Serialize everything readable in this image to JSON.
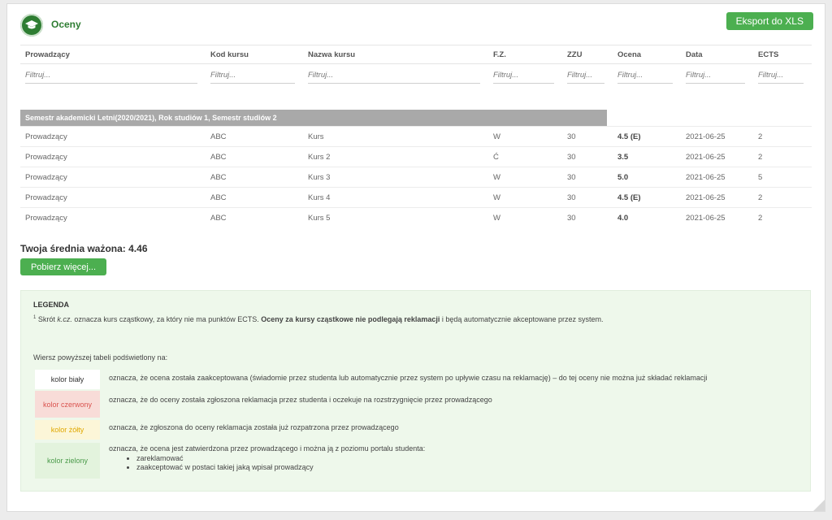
{
  "header": {
    "title": "Oceny",
    "export_label": "Eksport do XLS"
  },
  "table": {
    "columns": [
      "Prowadzący",
      "Kod kursu",
      "Nazwa kursu",
      "F.Z.",
      "ZZU",
      "Ocena",
      "Data",
      "ECTS"
    ],
    "filter_placeholder": "Filtruj...",
    "semester": "Semestr akademicki Letni(2020/2021), Rok studiów 1, Semestr studiów 2",
    "rows": [
      [
        "Prowadzący",
        "ABC",
        "Kurs",
        "W",
        "30",
        "4.5 (E)",
        "2021-06-25",
        "2"
      ],
      [
        "Prowadzący",
        "ABC",
        "Kurs 2",
        "Ć",
        "30",
        "3.5",
        "2021-06-25",
        "2"
      ],
      [
        "Prowadzący",
        "ABC",
        "Kurs 3",
        "W",
        "30",
        "5.0",
        "2021-06-25",
        "5"
      ],
      [
        "Prowadzący",
        "ABC",
        "Kurs 4",
        "W",
        "30",
        "4.5 (E)",
        "2021-06-25",
        "2"
      ],
      [
        "Prowadzący",
        "ABC",
        "Kurs 5",
        "W",
        "30",
        "4.0",
        "2021-06-25",
        "2"
      ]
    ]
  },
  "average": "Twoja średnia ważona: 4.46",
  "more_label": "Pobierz więcej...",
  "legend": {
    "title": "LEGENDA",
    "footnote_mark": "1",
    "note_prefix": " Skrót ",
    "note_abbr": "k.cz.",
    "note_mid": " oznacza kurs cząstkowy, za który nie ma punktów ECTS. ",
    "note_bold": "Oceny za kursy cząstkowe nie podlegają reklamacji",
    "note_suffix": " i będą automatycznie akceptowane przez system.",
    "intro": "Wiersz powyższej tabeli podświetlony na:",
    "items": [
      {
        "label": "kolor biały",
        "bg": "#ffffff",
        "fg": "#333333",
        "text": "oznacza, że ocena została zaakceptowana (świadomie przez studenta lub automatycznie przez system po upływie czasu na reklamację) – do tej oceny nie można już składać reklamacji"
      },
      {
        "label": "kolor czerwony",
        "bg": "#f8dcd8",
        "fg": "#d9534f",
        "text": "oznacza, że do oceny została zgłoszona reklamacja przez studenta i oczekuje na rozstrzygnięcie przez prowadzącego"
      },
      {
        "label": "kolor żółty",
        "bg": "#fcf6d8",
        "fg": "#e0a800",
        "text": "oznacza, że zgłoszona do oceny reklamacja została już rozpatrzona przez prowadzącego"
      },
      {
        "label": "kolor zielony",
        "bg": "#e3f3dd",
        "fg": "#4a9a4a",
        "text": "oznacza, że ocena jest zatwierdzona przez prowadzącego i można ją z poziomu portalu studenta:",
        "bullets": [
          "zareklamować",
          "zaakceptować w postaci takiej jaką wpisał prowadzący"
        ]
      }
    ]
  },
  "colors": {
    "accent": "#4caf50",
    "brand": "#2e7d32",
    "semester_bg": "#a9a9a9",
    "legend_bg": "#eef8eb"
  },
  "icons": {
    "logo": "graduation-cap-icon"
  }
}
